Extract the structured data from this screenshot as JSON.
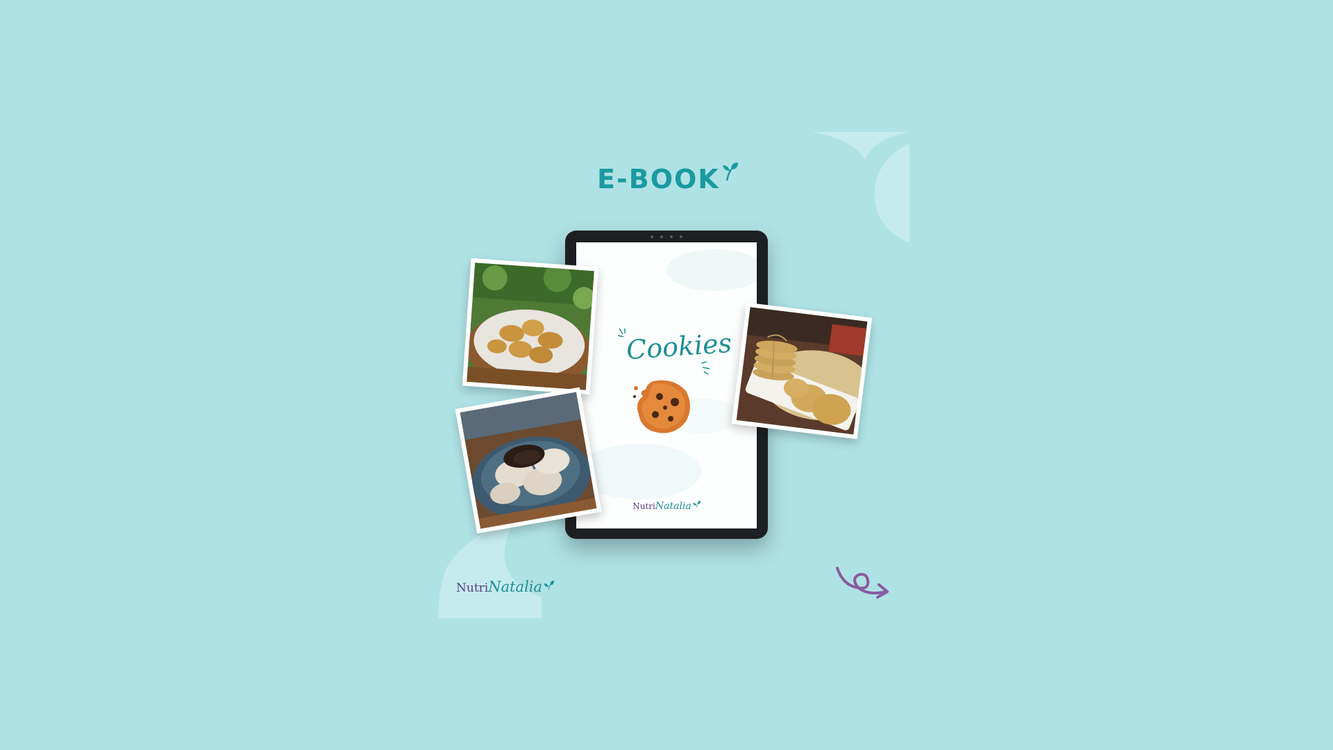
{
  "header": {
    "title": "E-BOOK"
  },
  "ebook_cover": {
    "title": "Cookies",
    "brand_prefix": "Nutri",
    "brand_name": "Natalia"
  },
  "footer_logo": {
    "brand_prefix": "Nutri",
    "brand_name": "Natalia"
  },
  "colors": {
    "background": "#afe2e5",
    "accent_teal": "#1a9aa0",
    "accent_purple": "#8a5aa0",
    "brand_purple": "#5a3e86"
  },
  "icons": {
    "title_decoration": "sprout-icon",
    "cover_illustration": "cookie-icon",
    "arrow": "swirl-arrow-icon"
  },
  "photos": [
    {
      "subject": "cookies in a cloth-lined bread basket"
    },
    {
      "subject": "chocolate-dipped cookies in a blue bowl"
    },
    {
      "subject": "stack of cookies tied with twine on a white plate"
    }
  ]
}
